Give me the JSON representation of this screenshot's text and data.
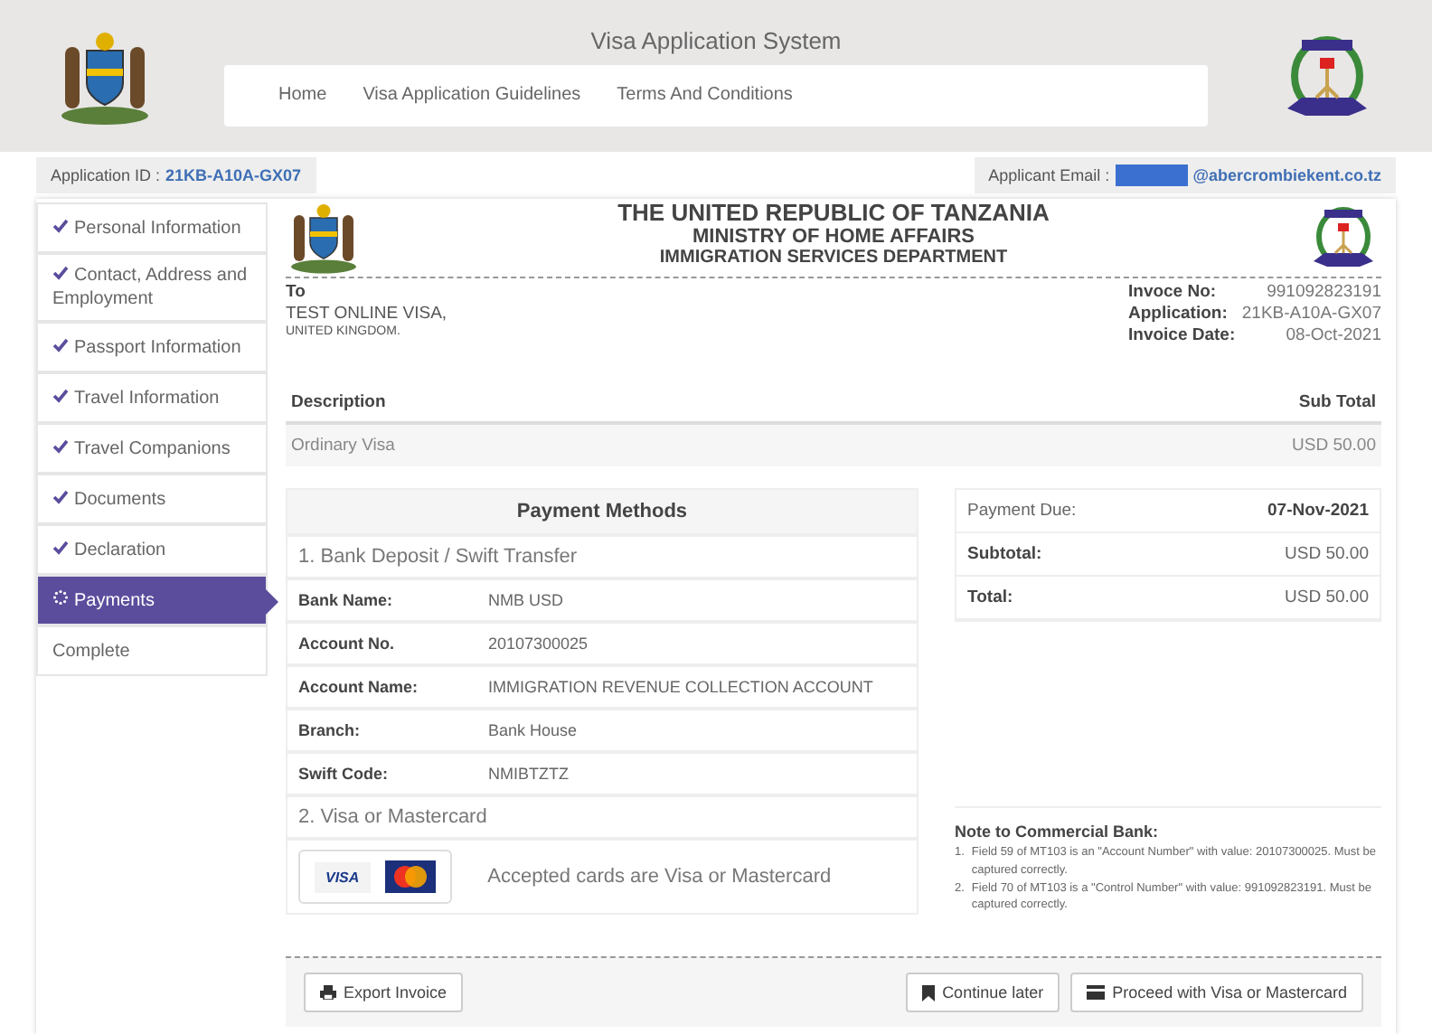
{
  "header": {
    "title": "Visa Application System",
    "nav": [
      {
        "label": "Home"
      },
      {
        "label": "Visa Application Guidelines"
      },
      {
        "label": "Terms And Conditions"
      }
    ]
  },
  "info_bar": {
    "application_label": "Application ID :",
    "application_id": "21KB-A10A-GX07",
    "email_label": "Applicant Email :",
    "email": "@abercrombiekent.co.tz"
  },
  "sidebar": {
    "items": [
      {
        "label": "Personal Information",
        "kind": "done",
        "selected": false
      },
      {
        "label": "Contact, Address and Employment",
        "kind": "done",
        "selected": false
      },
      {
        "label": "Passport Information",
        "kind": "done",
        "selected": false
      },
      {
        "label": "Travel Information",
        "kind": "done",
        "selected": false
      },
      {
        "label": "Travel Companions",
        "kind": "done",
        "selected": false
      },
      {
        "label": "Documents",
        "kind": "done",
        "selected": false
      },
      {
        "label": "Declaration",
        "kind": "done",
        "selected": false
      },
      {
        "label": "Payments",
        "kind": "current",
        "selected": true
      },
      {
        "label": "Complete",
        "kind": "pending",
        "selected": false
      }
    ]
  },
  "invoice": {
    "heading": [
      "THE UNITED REPUBLIC OF TANZANIA",
      "MINISTRY OF HOME AFFAIRS",
      "IMMIGRATION SERVICES DEPARTMENT"
    ],
    "to_label": "To",
    "to_name": "TEST ONLINE VISA,",
    "to_country": "UNITED KINGDOM.",
    "meta": [
      {
        "label": "Invoce No:",
        "value": "991092823191"
      },
      {
        "label": "Application:",
        "value": "21KB-A10A-GX07"
      },
      {
        "label": "Invoice Date:",
        "value": "08-Oct-2021"
      }
    ],
    "columns": [
      "Description",
      "Sub Total"
    ],
    "rows": [
      {
        "description": "Ordinary Visa",
        "subtotal": "USD 50.00"
      }
    ]
  },
  "payment_methods": {
    "title": "Payment Methods",
    "bank_title": "1. Bank Deposit / Swift Transfer",
    "bank_rows": [
      {
        "label": "Bank Name:",
        "value": "NMB USD"
      },
      {
        "label": "Account No.",
        "value": "20107300025"
      },
      {
        "label": "Account Name:",
        "value": "IMMIGRATION REVENUE COLLECTION ACCOUNT"
      },
      {
        "label": "Branch:",
        "value": "Bank House"
      },
      {
        "label": "Swift Code:",
        "value": "NMIBTZTZ"
      }
    ],
    "card_title": "2. Visa or Mastercard",
    "card_visa": "VISA",
    "card_text": "Accepted cards are Visa or Mastercard"
  },
  "summary": [
    {
      "label": "Payment Due:",
      "value": "07-Nov-2021",
      "kind": "due"
    },
    {
      "label": "Subtotal:",
      "value": "USD 50.00",
      "kind": "amount"
    },
    {
      "label": "Total:",
      "value": "USD 50.00",
      "kind": "amount"
    }
  ],
  "note": {
    "title": "Note to Commercial Bank:",
    "items": [
      {
        "marker": "1.",
        "text": "Field 59 of MT103 is an \"Account Number\" with value: 20107300025. Must be captured correctly."
      },
      {
        "marker": "2.",
        "text": "Field 70 of MT103 is a \"Control Number\" with value: 991092823191. Must be captured correctly."
      }
    ]
  },
  "buttons": {
    "export": "Export Invoice",
    "later": "Continue later",
    "proceed": "Proceed with Visa or Mastercard"
  }
}
